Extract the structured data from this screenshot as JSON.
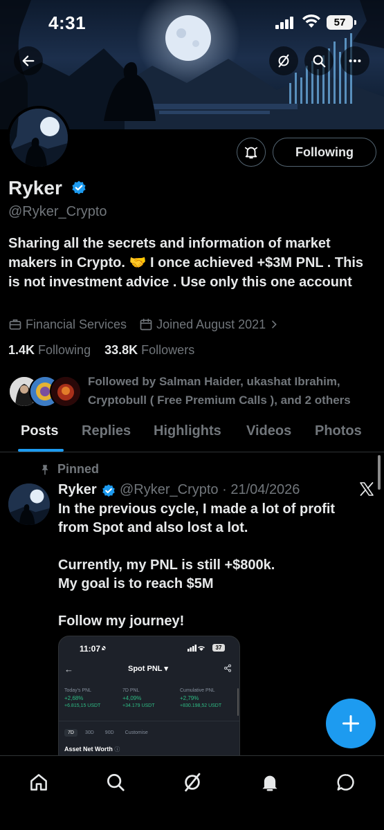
{
  "status_bar": {
    "time": "4:31",
    "battery": "57"
  },
  "icons": {
    "back": "back-arrow-icon",
    "grok": "grok-icon",
    "search": "search-icon",
    "more": "more-icon",
    "notify": "notification-bell-icon",
    "verified": "verified-badge-icon",
    "briefcase": "briefcase-icon",
    "calendar": "calendar-icon",
    "pin": "pin-icon",
    "x_logo": "x-logo-icon",
    "compose": "plus-icon"
  },
  "profile": {
    "name": "Ryker",
    "handle": "@Ryker_Crypto",
    "follow_button": "Following",
    "bio": "Sharing all the secrets and information of market makers in Crypto. 🤝 I once achieved +$3M PNL . This is not investment advice . Use only this one account",
    "category": "Financial Services",
    "joined": "Joined August 2021",
    "following_count": "1.4K",
    "following_label": "Following",
    "followers_count": "33.8K",
    "followers_label": "Followers",
    "followed_by": "Followed by Salman Haider, ukashat Ibrahim, Cryptobull ( Free Premium Calls ), and 2 others"
  },
  "tabs": [
    {
      "label": "Posts",
      "active": true
    },
    {
      "label": "Replies"
    },
    {
      "label": "Highlights"
    },
    {
      "label": "Videos"
    },
    {
      "label": "Photos"
    }
  ],
  "post": {
    "pinned_label": "Pinned",
    "author": "Ryker",
    "handle_date": "@Ryker_Crypto · 21/04/2026",
    "text": "In the previous cycle, I made a lot of profit from Spot and also lost a lot.\n\nCurrently, my PNL is still +$800k.\nMy goal is to reach $5M\n\nFollow my journey!",
    "media": {
      "time": "11:07",
      "battery": "37",
      "title": "Spot PNL ▾",
      "columns": [
        {
          "label": "Today's PNL",
          "pct": "+2,68%",
          "usdt": "+6.815,15 USDT"
        },
        {
          "label": "7D PNL",
          "pct": "+4,09%",
          "usdt": "+34.179 USDT"
        },
        {
          "label": "Cumulative PNL",
          "pct": "+2,79%",
          "usdt": "+830.198,52 USDT"
        }
      ],
      "ranges": [
        "7D",
        "30D",
        "90D",
        "Customise"
      ],
      "net_worth_label": "Asset Net Worth"
    }
  },
  "bottom_nav": [
    "home-icon",
    "search-icon",
    "grok-icon",
    "notifications-icon",
    "messages-icon"
  ],
  "colors": {
    "accent": "#1d9bf0",
    "muted": "#71767b",
    "profit_green": "#2ebd85"
  }
}
